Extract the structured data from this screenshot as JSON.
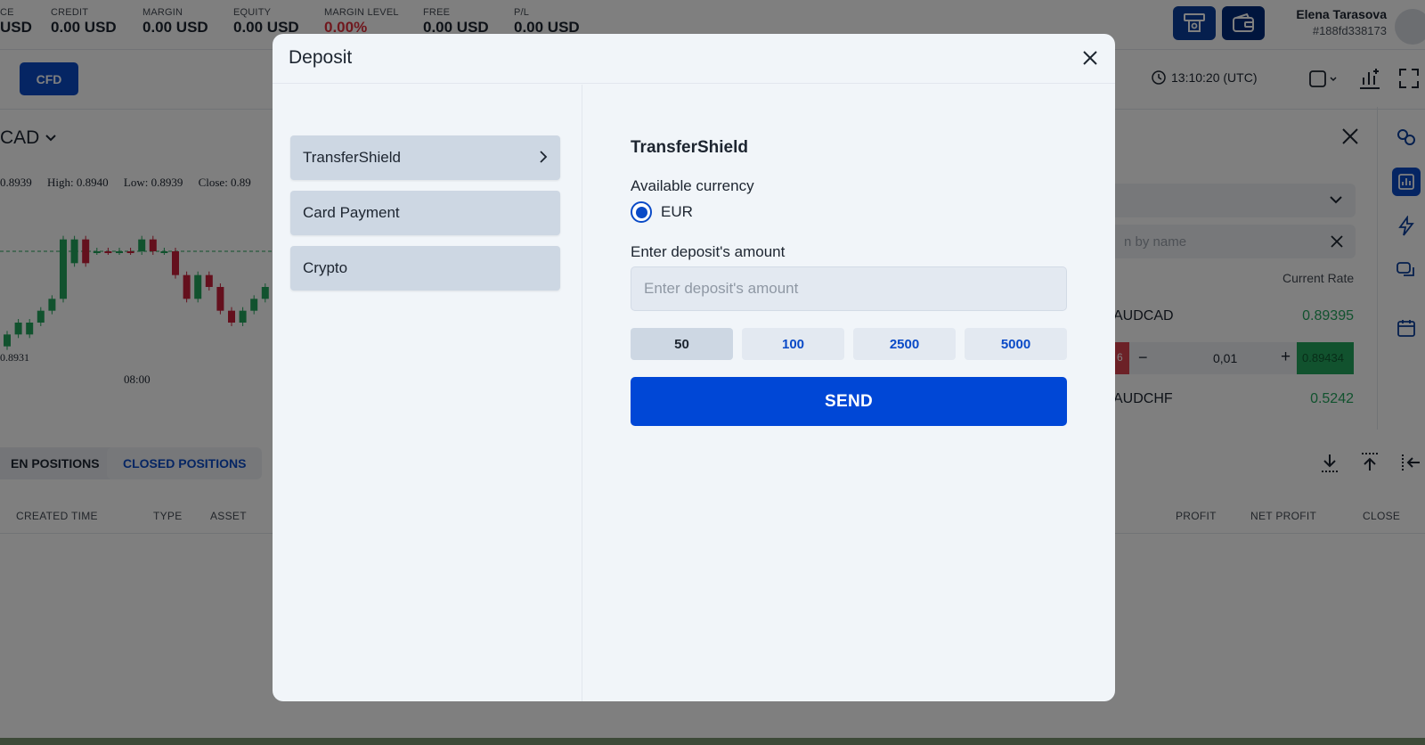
{
  "account": {
    "balance_label_fragment": "CE",
    "balance_value_fragment": "USD",
    "stats": [
      {
        "label": "CREDIT",
        "value": "0.00 USD"
      },
      {
        "label": "MARGIN",
        "value": "0.00 USD"
      },
      {
        "label": "EQUITY",
        "value": "0.00 USD"
      },
      {
        "label": "MARGIN LEVEL",
        "value": "0.00%"
      },
      {
        "label": "FREE",
        "value": "0.00 USD"
      },
      {
        "label": "P/L",
        "value": "0.00 USD"
      }
    ]
  },
  "user": {
    "name": "Elena Tarasova",
    "id": "#188fd338173"
  },
  "toolbar": {
    "cfd_label": "CFD",
    "clock": "13:10:20 (UTC)"
  },
  "chart": {
    "symbol_fragment": "CAD",
    "ohlc": {
      "open_fragment": "0.8939",
      "high": "High: 0.8940",
      "low": "Low: 0.8939",
      "close_fragment": "Close: 0.89"
    },
    "price_label": "0.8931",
    "time_label": "08:00"
  },
  "chart_data": {
    "type": "candlestick",
    "x_tick_labels": [
      "08:00"
    ],
    "y_tick_labels": [
      "0.8931"
    ],
    "candles": [
      {
        "o": 0.893,
        "c": 0.8931,
        "up": true
      },
      {
        "o": 0.8931,
        "c": 0.8932,
        "up": true
      },
      {
        "o": 0.8931,
        "c": 0.8932,
        "up": true
      },
      {
        "o": 0.8932,
        "c": 0.8933,
        "up": true
      },
      {
        "o": 0.8933,
        "c": 0.8934,
        "up": true
      },
      {
        "o": 0.8934,
        "c": 0.8939,
        "up": true
      },
      {
        "o": 0.8937,
        "c": 0.8939,
        "up": true
      },
      {
        "o": 0.8939,
        "c": 0.8937,
        "up": false
      },
      {
        "o": 0.8938,
        "c": 0.8938,
        "up": true
      },
      {
        "o": 0.8938,
        "c": 0.8938,
        "up": false
      },
      {
        "o": 0.8938,
        "c": 0.8938,
        "up": true
      },
      {
        "o": 0.8938,
        "c": 0.8938,
        "up": false
      },
      {
        "o": 0.8938,
        "c": 0.8939,
        "up": true
      },
      {
        "o": 0.8939,
        "c": 0.8938,
        "up": false
      },
      {
        "o": 0.8938,
        "c": 0.8938,
        "up": true
      },
      {
        "o": 0.8938,
        "c": 0.8936,
        "up": false
      },
      {
        "o": 0.8936,
        "c": 0.8934,
        "up": false
      },
      {
        "o": 0.8934,
        "c": 0.8936,
        "up": true
      },
      {
        "o": 0.8936,
        "c": 0.8935,
        "up": false
      },
      {
        "o": 0.8935,
        "c": 0.8933,
        "up": false
      },
      {
        "o": 0.8933,
        "c": 0.8932,
        "up": false
      },
      {
        "o": 0.8932,
        "c": 0.8933,
        "up": true
      },
      {
        "o": 0.8933,
        "c": 0.8934,
        "up": true
      },
      {
        "o": 0.8934,
        "c": 0.8935,
        "up": true
      }
    ],
    "reference_line": 0.8938
  },
  "right_panel": {
    "search_placeholder": "n by name",
    "column_header": "Current Rate",
    "instruments": [
      {
        "symbol": "AUDCAD",
        "rate": "0.89395"
      },
      {
        "symbol": "AUDCHF",
        "rate": "0.5242"
      }
    ],
    "trade": {
      "sell_fragment": "6",
      "lot": "0,01",
      "buy_rate": "0.89434",
      "minus": "−",
      "plus": "+"
    }
  },
  "positions": {
    "tabs": [
      {
        "label": "EN POSITIONS"
      },
      {
        "label": "CLOSED POSITIONS"
      }
    ],
    "columns_left": [
      "CREATED TIME",
      "TYPE",
      "ASSET"
    ],
    "columns_right": [
      "PROFIT",
      "NET PROFIT",
      "CLOSE"
    ]
  },
  "modal": {
    "title": "Deposit",
    "methods": [
      {
        "label": "TransferShield",
        "active": true
      },
      {
        "label": "Card Payment"
      },
      {
        "label": "Crypto"
      }
    ],
    "provider_title": "TransferShield",
    "currency_label": "Available currency",
    "currency_option": "EUR",
    "amount_label": "Enter deposit's amount",
    "amount_placeholder": "Enter deposit's amount",
    "amount_value": "",
    "quick_amounts": [
      "50",
      "100",
      "2500",
      "5000"
    ],
    "selected_quick_amount": "50",
    "send_label": "SEND"
  },
  "colors": {
    "accent": "#0047d6",
    "positive": "#23a45d",
    "negative": "#e0303d",
    "candle_up": "#23a45d",
    "candle_down": "#c8203a"
  }
}
